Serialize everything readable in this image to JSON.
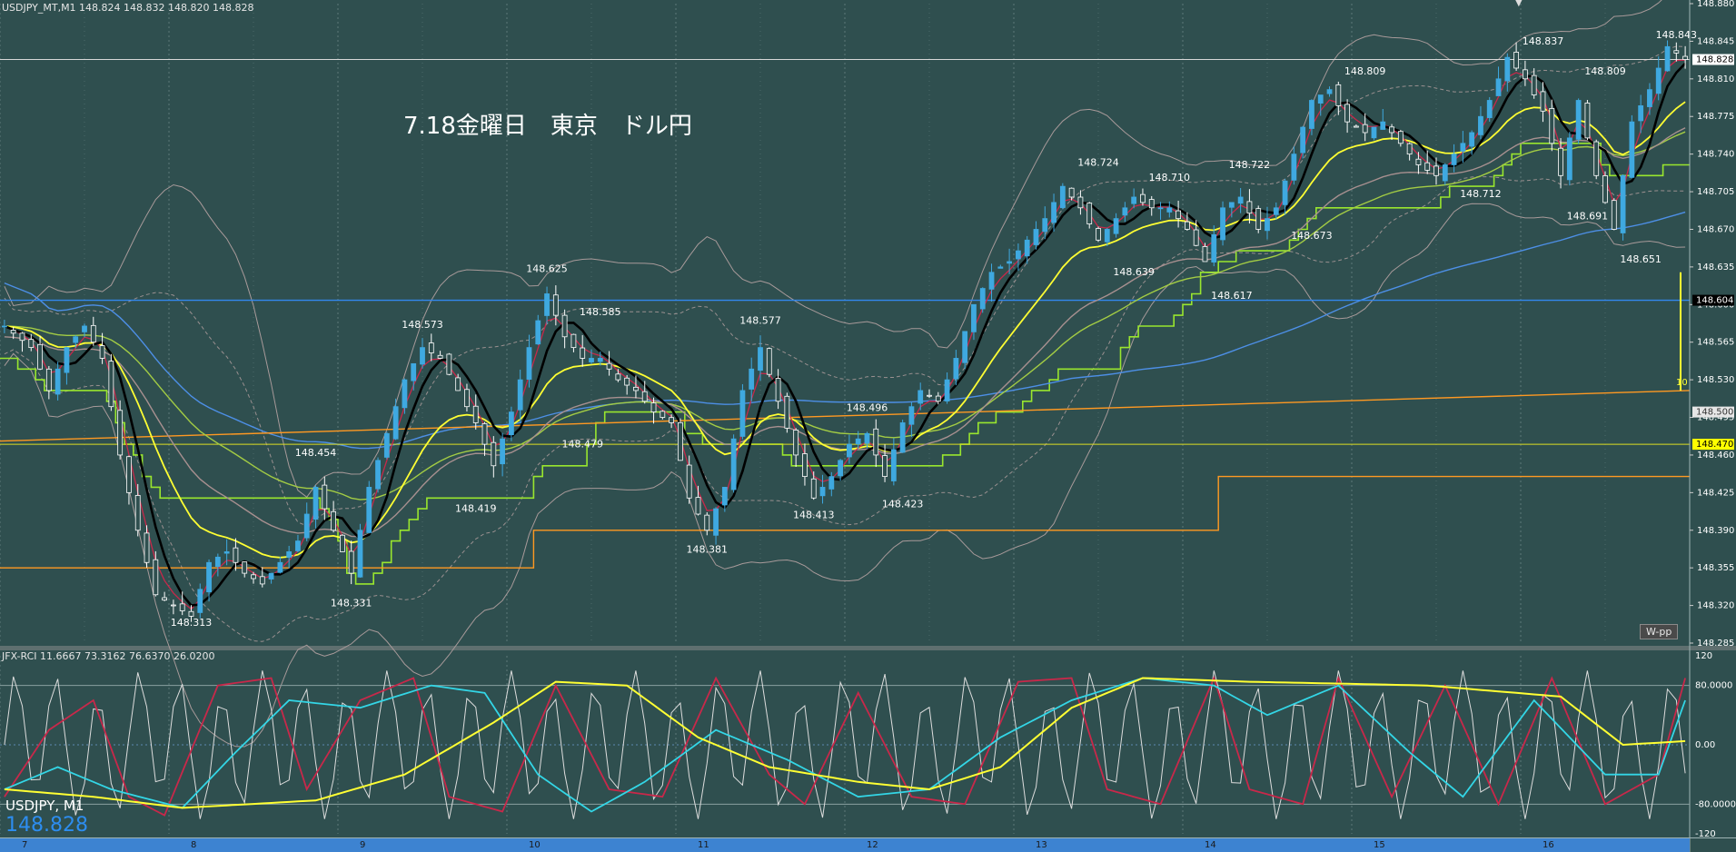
{
  "window": {
    "header": "USDJPY_MT,M1  148.824 148.832 148.820 148.828",
    "annotation": "7.18金曜日　東京　ドル円",
    "symbol_label": "USDJPY, M1",
    "big_price": "148.828",
    "wpp_label": "W-pp",
    "indicator_header": "JFX-RCI 11.6667 73.3162 76.6370 26.0200",
    "line_badge": "10"
  },
  "colors": {
    "background": "#2f4f4f",
    "candle_up": "#3fa9e0",
    "candle_down": "#ffffff",
    "ma_black": "#000000",
    "ma_yellow": "#ffff33",
    "ma_red": "#c8284a",
    "rci_white": "#dddddd",
    "rci_red": "#c8284a",
    "rci_cyan": "#33d6e6",
    "rci_yellow": "#ffff33",
    "grid": "#5e7a7a",
    "green_step": "#99e62e",
    "blue_line": "#3388ee",
    "orange_line": "#ff9922"
  },
  "chart_data": {
    "type": "line",
    "instrument": "USDJPY",
    "timeframe": "M1",
    "x_ticks": [
      "7",
      "8",
      "9",
      "10",
      "11",
      "12",
      "13",
      "14",
      "15",
      "16"
    ],
    "ylim": [
      148.285,
      148.88
    ],
    "y_ticks": [
      "148.880",
      "148.845",
      "148.810",
      "148.775",
      "148.740",
      "148.705",
      "148.670",
      "148.635",
      "148.600",
      "148.565",
      "148.530",
      "148.495",
      "148.460",
      "148.425",
      "148.390",
      "148.355",
      "148.320",
      "148.285"
    ],
    "price_badges": [
      {
        "label": "148.828",
        "value": 148.828,
        "bg": "#ffffff",
        "fg": "#000000"
      },
      {
        "label": "148.604",
        "value": 148.604,
        "bg": "#000000",
        "fg": "#ffffff"
      },
      {
        "label": "148.500",
        "value": 148.5,
        "bg": "#e6e6e6",
        "fg": "#333333"
      },
      {
        "label": "148.470",
        "value": 148.47,
        "bg": "#ffff00",
        "fg": "#000000"
      }
    ],
    "close_anchors": [
      [
        0,
        148.58
      ],
      [
        3,
        148.56
      ],
      [
        5,
        148.52
      ],
      [
        7,
        148.56
      ],
      [
        9,
        148.58
      ],
      [
        11,
        148.55
      ],
      [
        13,
        148.46
      ],
      [
        15,
        148.39
      ],
      [
        17,
        148.33
      ],
      [
        19,
        148.32
      ],
      [
        21,
        148.31
      ],
      [
        23,
        148.36
      ],
      [
        25,
        148.37
      ],
      [
        27,
        148.35
      ],
      [
        29,
        148.34
      ],
      [
        31,
        148.36
      ],
      [
        33,
        148.38
      ],
      [
        35,
        148.43
      ],
      [
        37,
        148.39
      ],
      [
        39,
        148.35
      ],
      [
        41,
        148.43
      ],
      [
        43,
        148.48
      ],
      [
        45,
        148.53
      ],
      [
        47,
        148.56
      ],
      [
        49,
        148.55
      ],
      [
        51,
        148.52
      ],
      [
        53,
        148.49
      ],
      [
        55,
        148.45
      ],
      [
        57,
        148.5
      ],
      [
        59,
        148.56
      ],
      [
        61,
        148.61
      ],
      [
        63,
        148.57
      ],
      [
        65,
        148.55
      ],
      [
        67,
        148.55
      ],
      [
        69,
        148.53
      ],
      [
        71,
        148.52
      ],
      [
        73,
        148.5
      ],
      [
        75,
        148.49
      ],
      [
        77,
        148.42
      ],
      [
        79,
        148.39
      ],
      [
        81,
        148.43
      ],
      [
        83,
        148.52
      ],
      [
        85,
        148.56
      ],
      [
        87,
        148.51
      ],
      [
        89,
        148.46
      ],
      [
        91,
        148.42
      ],
      [
        93,
        148.44
      ],
      [
        95,
        148.47
      ],
      [
        97,
        148.48
      ],
      [
        99,
        148.44
      ],
      [
        101,
        148.49
      ],
      [
        103,
        148.52
      ],
      [
        105,
        148.51
      ],
      [
        107,
        148.55
      ],
      [
        109,
        148.6
      ],
      [
        111,
        148.63
      ],
      [
        113,
        148.64
      ],
      [
        115,
        148.66
      ],
      [
        117,
        148.68
      ],
      [
        119,
        148.71
      ],
      [
        121,
        148.69
      ],
      [
        123,
        148.66
      ],
      [
        125,
        148.68
      ],
      [
        127,
        148.7
      ],
      [
        129,
        148.69
      ],
      [
        131,
        148.69
      ],
      [
        133,
        148.67
      ],
      [
        135,
        148.64
      ],
      [
        137,
        148.69
      ],
      [
        139,
        148.7
      ],
      [
        141,
        148.67
      ],
      [
        143,
        148.69
      ],
      [
        145,
        148.74
      ],
      [
        147,
        148.79
      ],
      [
        149,
        148.8
      ],
      [
        151,
        148.77
      ],
      [
        153,
        148.76
      ],
      [
        155,
        148.77
      ],
      [
        157,
        148.75
      ],
      [
        159,
        148.73
      ],
      [
        161,
        148.72
      ],
      [
        163,
        148.74
      ],
      [
        165,
        148.76
      ],
      [
        167,
        148.79
      ],
      [
        169,
        148.83
      ],
      [
        171,
        148.81
      ],
      [
        173,
        148.78
      ],
      [
        175,
        148.72
      ],
      [
        177,
        148.79
      ],
      [
        179,
        148.72
      ],
      [
        181,
        148.67
      ],
      [
        183,
        148.77
      ],
      [
        185,
        148.8
      ],
      [
        187,
        148.84
      ],
      [
        189,
        148.828
      ]
    ],
    "peak_labels": [
      {
        "text": "148.313",
        "idx": 21,
        "price": 148.313,
        "pos": "below"
      },
      {
        "text": "148.331",
        "idx": 39,
        "price": 148.331,
        "pos": "below"
      },
      {
        "text": "148.454",
        "idx": 35,
        "price": 148.454,
        "pos": "above"
      },
      {
        "text": "148.573",
        "idx": 47,
        "price": 148.573,
        "pos": "above"
      },
      {
        "text": "148.419",
        "idx": 53,
        "price": 148.419,
        "pos": "below"
      },
      {
        "text": "148.625",
        "idx": 61,
        "price": 148.625,
        "pos": "above"
      },
      {
        "text": "148.585",
        "idx": 67,
        "price": 148.585,
        "pos": "above"
      },
      {
        "text": "148.479",
        "idx": 65,
        "price": 148.479,
        "pos": "below"
      },
      {
        "text": "148.381",
        "idx": 79,
        "price": 148.381,
        "pos": "below"
      },
      {
        "text": "148.577",
        "idx": 85,
        "price": 148.577,
        "pos": "above"
      },
      {
        "text": "148.413",
        "idx": 91,
        "price": 148.413,
        "pos": "below"
      },
      {
        "text": "148.496",
        "idx": 97,
        "price": 148.496,
        "pos": "above"
      },
      {
        "text": "148.423",
        "idx": 101,
        "price": 148.423,
        "pos": "below"
      },
      {
        "text": "148.724",
        "idx": 123,
        "price": 148.724,
        "pos": "above"
      },
      {
        "text": "148.639",
        "idx": 127,
        "price": 148.639,
        "pos": "below"
      },
      {
        "text": "148.710",
        "idx": 131,
        "price": 148.71,
        "pos": "above"
      },
      {
        "text": "148.722",
        "idx": 140,
        "price": 148.722,
        "pos": "above"
      },
      {
        "text": "148.617",
        "idx": 138,
        "price": 148.617,
        "pos": "below"
      },
      {
        "text": "148.673",
        "idx": 147,
        "price": 148.673,
        "pos": "below"
      },
      {
        "text": "148.809",
        "idx": 153,
        "price": 148.809,
        "pos": "above"
      },
      {
        "text": "148.712",
        "idx": 166,
        "price": 148.712,
        "pos": "below"
      },
      {
        "text": "148.837",
        "idx": 173,
        "price": 148.837,
        "pos": "above"
      },
      {
        "text": "148.809",
        "idx": 180,
        "price": 148.809,
        "pos": "above"
      },
      {
        "text": "148.691",
        "idx": 178,
        "price": 148.691,
        "pos": "below"
      },
      {
        "text": "148.651",
        "idx": 184,
        "price": 148.651,
        "pos": "below"
      },
      {
        "text": "148.843",
        "idx": 188,
        "price": 148.843,
        "pos": "above"
      }
    ],
    "horizontal_levels": [
      {
        "name": "resistance",
        "value": 148.828,
        "color": "#d8d8d8"
      },
      {
        "name": "support-yellow",
        "value": 148.47,
        "color": "#dddd22"
      }
    ],
    "indicator": {
      "name": "JFX-RCI",
      "values": [
        11.6667,
        73.3162,
        76.637,
        26.02
      ],
      "ylim": [
        -120,
        120
      ],
      "ticks": [
        {
          "label": "120",
          "value": 120
        },
        {
          "label": "80.0000",
          "value": 80
        },
        {
          "label": "0.00",
          "value": 0
        },
        {
          "label": "-80.0000",
          "value": -80
        },
        {
          "label": "-120",
          "value": -120
        }
      ],
      "yellow_anchors": [
        [
          0,
          -60
        ],
        [
          10,
          -70
        ],
        [
          20,
          -85
        ],
        [
          35,
          -75
        ],
        [
          45,
          -40
        ],
        [
          55,
          30
        ],
        [
          62,
          85
        ],
        [
          70,
          80
        ],
        [
          78,
          10
        ],
        [
          86,
          -30
        ],
        [
          96,
          -50
        ],
        [
          104,
          -60
        ],
        [
          112,
          -30
        ],
        [
          120,
          50
        ],
        [
          128,
          90
        ],
        [
          140,
          85
        ],
        [
          160,
          80
        ],
        [
          175,
          65
        ],
        [
          182,
          0
        ],
        [
          189,
          5
        ]
      ],
      "cyan_anchors": [
        [
          0,
          -60
        ],
        [
          6,
          -30
        ],
        [
          12,
          -60
        ],
        [
          20,
          -85
        ],
        [
          26,
          -10
        ],
        [
          32,
          60
        ],
        [
          40,
          50
        ],
        [
          48,
          80
        ],
        [
          54,
          70
        ],
        [
          60,
          -40
        ],
        [
          66,
          -90
        ],
        [
          72,
          -50
        ],
        [
          80,
          20
        ],
        [
          88,
          -20
        ],
        [
          96,
          -70
        ],
        [
          104,
          -60
        ],
        [
          112,
          10
        ],
        [
          120,
          60
        ],
        [
          128,
          90
        ],
        [
          136,
          80
        ],
        [
          142,
          40
        ],
        [
          150,
          80
        ],
        [
          158,
          -10
        ],
        [
          164,
          -70
        ],
        [
          172,
          60
        ],
        [
          180,
          -40
        ],
        [
          186,
          -40
        ],
        [
          189,
          60
        ]
      ],
      "red_anchors": [
        [
          0,
          -70
        ],
        [
          5,
          20
        ],
        [
          10,
          60
        ],
        [
          14,
          -70
        ],
        [
          18,
          -95
        ],
        [
          24,
          80
        ],
        [
          30,
          90
        ],
        [
          34,
          -60
        ],
        [
          40,
          60
        ],
        [
          46,
          90
        ],
        [
          50,
          -70
        ],
        [
          56,
          -90
        ],
        [
          62,
          80
        ],
        [
          68,
          -60
        ],
        [
          74,
          -70
        ],
        [
          80,
          90
        ],
        [
          86,
          -40
        ],
        [
          90,
          -80
        ],
        [
          96,
          70
        ],
        [
          102,
          -70
        ],
        [
          108,
          -80
        ],
        [
          114,
          85
        ],
        [
          120,
          90
        ],
        [
          124,
          -60
        ],
        [
          130,
          -80
        ],
        [
          136,
          90
        ],
        [
          140,
          -60
        ],
        [
          146,
          -80
        ],
        [
          150,
          90
        ],
        [
          156,
          -70
        ],
        [
          162,
          80
        ],
        [
          168,
          -80
        ],
        [
          174,
          90
        ],
        [
          180,
          -80
        ],
        [
          186,
          -40
        ],
        [
          189,
          90
        ]
      ]
    }
  }
}
